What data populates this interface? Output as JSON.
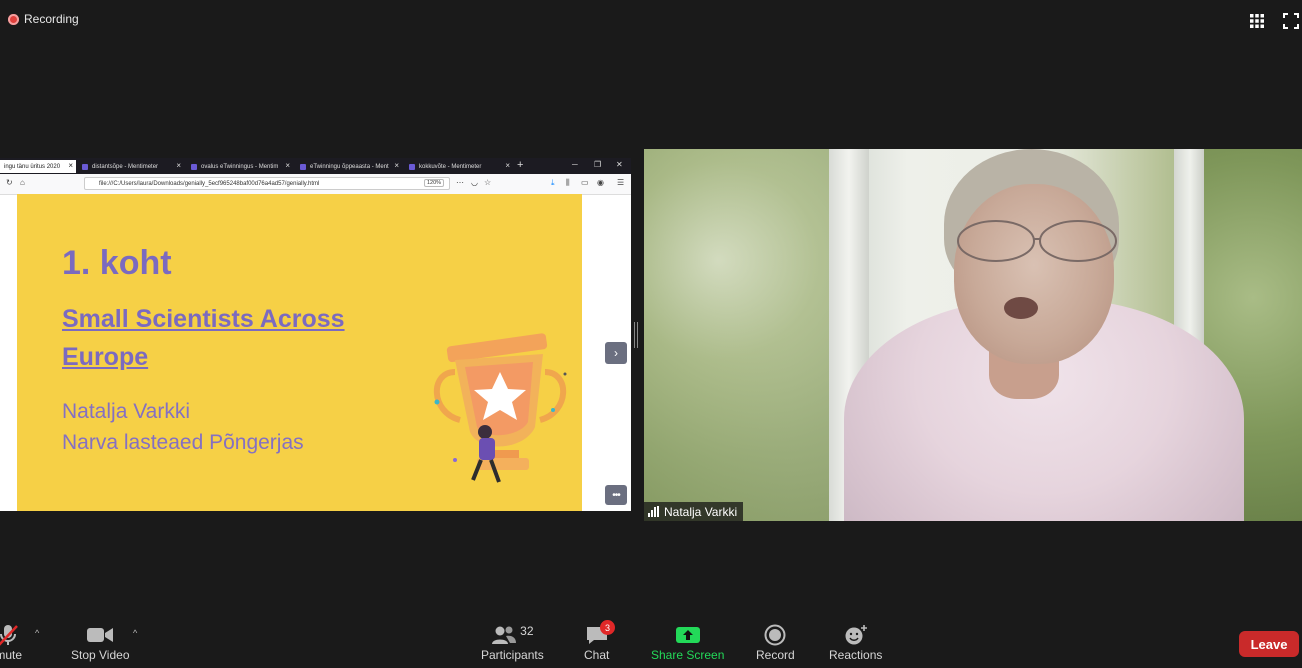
{
  "recording": {
    "label": "Recording"
  },
  "browser": {
    "tabs": [
      {
        "title": "ingu tänu üritus 2020",
        "active": true
      },
      {
        "title": "distantsõpe - Mentimeter",
        "active": false
      },
      {
        "title": "ovalus eTwinningus - Mentim",
        "active": false
      },
      {
        "title": "eTwinningu õppeaasta - Ment",
        "active": false
      },
      {
        "title": "kokkuvõte - Mentimeter",
        "active": false
      }
    ],
    "new_tab": "+",
    "url": "file:///C:/Users/laura/Downloads/genially_5ecf965248baf00d76a4ad57/genially.html",
    "zoom": "120%"
  },
  "slide": {
    "title": "1. koht",
    "project_line1": "Small Scientists Across",
    "project_line2": "Europe",
    "name": "Natalja Varkki",
    "school": "Narva lasteaed Põngerjas",
    "background_color": "#f6d046",
    "accent_color": "#7b6ac0"
  },
  "video": {
    "participant_name": "Natalja Varkki"
  },
  "toolbar": {
    "unmute_label": "Unmute",
    "stop_video_label": "Stop Video",
    "participants_label": "Participants",
    "participants_count": "32",
    "chat_label": "Chat",
    "chat_badge": "3",
    "share_label": "Share Screen",
    "record_label": "Record",
    "reactions_label": "Reactions",
    "leave_label": "Leave",
    "share_color": "#23d959",
    "leave_color": "#c92a2a"
  }
}
